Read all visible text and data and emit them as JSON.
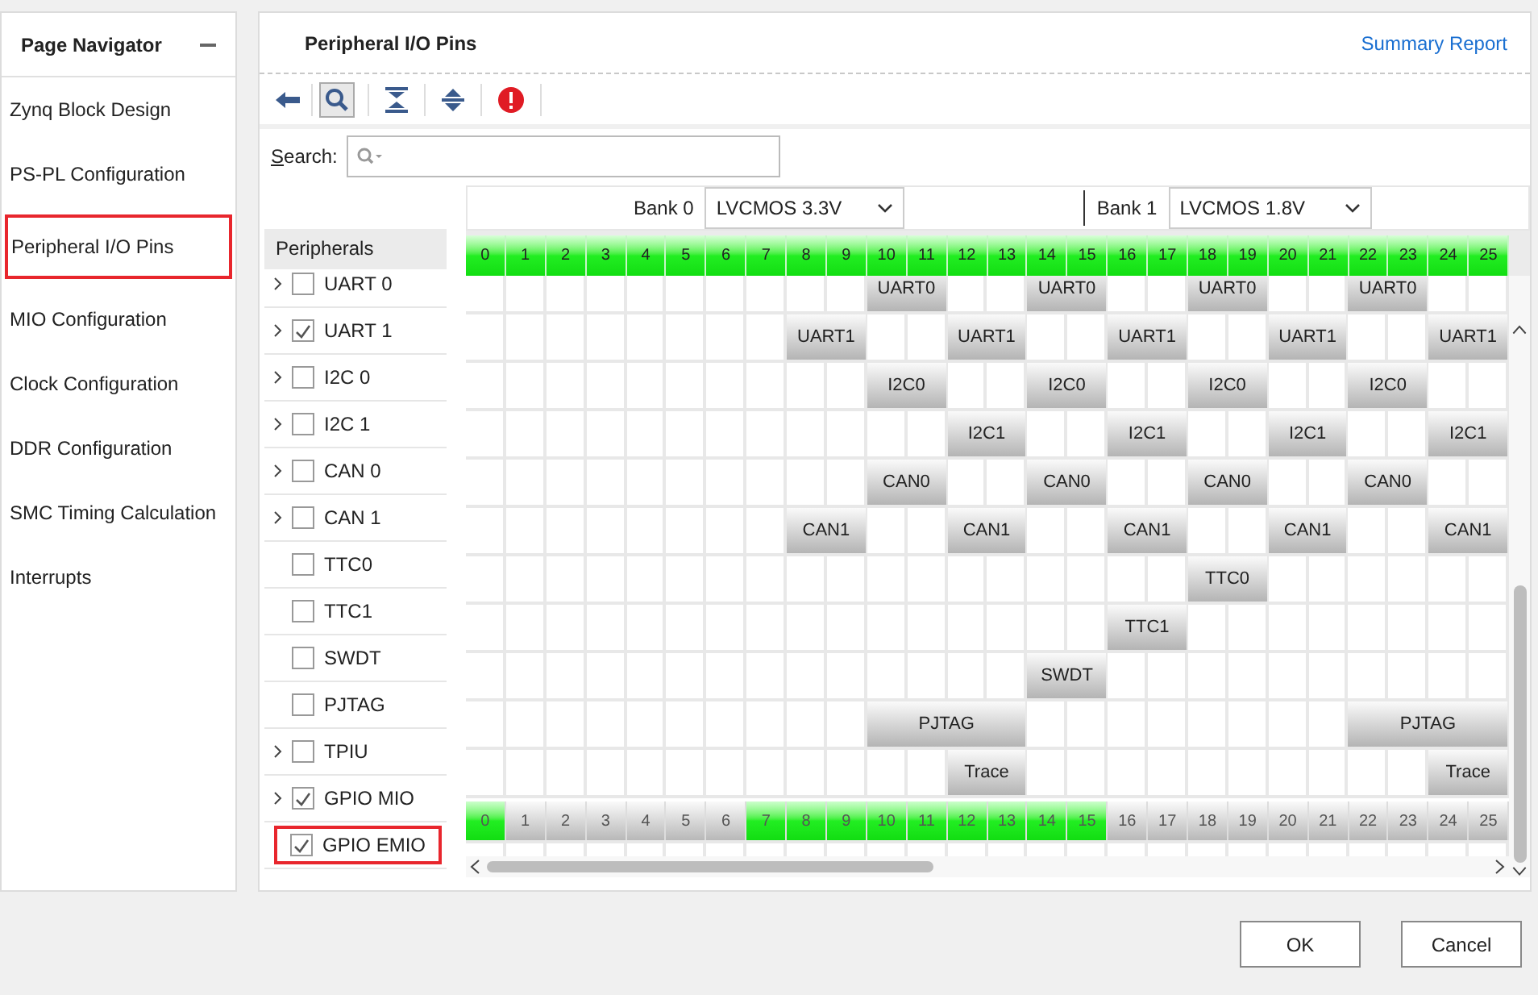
{
  "navigator": {
    "title": "Page Navigator",
    "items": [
      {
        "label": "Zynq Block Design",
        "selected": false
      },
      {
        "label": "PS-PL Configuration",
        "selected": false
      },
      {
        "label": "Peripheral I/O Pins",
        "selected": true
      },
      {
        "label": "MIO Configuration",
        "selected": false
      },
      {
        "label": "Clock Configuration",
        "selected": false
      },
      {
        "label": "DDR Configuration",
        "selected": false
      },
      {
        "label": "SMC Timing Calculation",
        "selected": false
      },
      {
        "label": "Interrupts",
        "selected": false
      }
    ]
  },
  "main": {
    "title": "Peripheral I/O Pins",
    "summary_link": "Summary Report",
    "search": {
      "label": "Search:"
    },
    "banks": [
      {
        "label": "Bank 0",
        "value": "LVCMOS 3.3V"
      },
      {
        "label": "Bank 1",
        "value": "LVCMOS 1.8V"
      }
    ],
    "peripherals_header": "Peripherals",
    "peripherals": [
      {
        "label": "UART 0",
        "expandable": true,
        "checked": false,
        "highlighted": false
      },
      {
        "label": "UART 1",
        "expandable": true,
        "checked": true,
        "highlighted": false
      },
      {
        "label": "I2C 0",
        "expandable": true,
        "checked": false,
        "highlighted": false
      },
      {
        "label": "I2C 1",
        "expandable": true,
        "checked": false,
        "highlighted": false
      },
      {
        "label": "CAN 0",
        "expandable": true,
        "checked": false,
        "highlighted": false
      },
      {
        "label": "CAN 1",
        "expandable": true,
        "checked": false,
        "highlighted": false
      },
      {
        "label": "TTC0",
        "expandable": false,
        "checked": false,
        "highlighted": false
      },
      {
        "label": "TTC1",
        "expandable": false,
        "checked": false,
        "highlighted": false
      },
      {
        "label": "SWDT",
        "expandable": false,
        "checked": false,
        "highlighted": false
      },
      {
        "label": "PJTAG",
        "expandable": false,
        "checked": false,
        "highlighted": false
      },
      {
        "label": "TPIU",
        "expandable": true,
        "checked": false,
        "highlighted": false
      },
      {
        "label": "GPIO MIO",
        "expandable": true,
        "checked": true,
        "highlighted": false
      },
      {
        "label": "GPIO EMIO",
        "expandable": false,
        "checked": true,
        "highlighted": true
      }
    ],
    "pin_header": [
      "0",
      "1",
      "2",
      "3",
      "4",
      "5",
      "6",
      "7",
      "8",
      "9",
      "10",
      "11",
      "12",
      "13",
      "14",
      "15",
      "16",
      "17",
      "18",
      "19",
      "20",
      "21",
      "22",
      "23",
      "24",
      "25"
    ],
    "pin_rows": [
      {
        "cells": [
          {
            "kind": "free"
          },
          {
            "kind": "free"
          },
          {
            "kind": "free"
          },
          {
            "kind": "free"
          },
          {
            "kind": "free"
          },
          {
            "kind": "free"
          },
          {
            "kind": "free"
          },
          {
            "kind": "free"
          },
          {
            "kind": "free"
          },
          {
            "kind": "free"
          },
          {
            "kind": "double",
            "label": "UART0"
          },
          {
            "kind": "free"
          },
          {
            "kind": "free"
          },
          {
            "kind": "double",
            "label": "UART0"
          },
          {
            "kind": "free"
          },
          {
            "kind": "free"
          },
          {
            "kind": "double",
            "label": "UART0"
          },
          {
            "kind": "free"
          },
          {
            "kind": "free"
          },
          {
            "kind": "double",
            "label": "UART0"
          },
          {
            "kind": "free"
          },
          {
            "kind": "free"
          }
        ]
      },
      {
        "cells": [
          {
            "kind": "free"
          },
          {
            "kind": "free"
          },
          {
            "kind": "free"
          },
          {
            "kind": "free"
          },
          {
            "kind": "free"
          },
          {
            "kind": "free"
          },
          {
            "kind": "free"
          },
          {
            "kind": "free"
          },
          {
            "kind": "double",
            "label": "UART1"
          },
          {
            "kind": "free"
          },
          {
            "kind": "free"
          },
          {
            "kind": "double",
            "label": "UART1"
          },
          {
            "kind": "free"
          },
          {
            "kind": "free"
          },
          {
            "kind": "double",
            "label": "UART1"
          },
          {
            "kind": "free"
          },
          {
            "kind": "free"
          },
          {
            "kind": "double",
            "label": "UART1"
          },
          {
            "kind": "free"
          },
          {
            "kind": "free"
          },
          {
            "kind": "double",
            "label": "UART1"
          }
        ]
      },
      {
        "cells": [
          {
            "kind": "free"
          },
          {
            "kind": "free"
          },
          {
            "kind": "free"
          },
          {
            "kind": "free"
          },
          {
            "kind": "free"
          },
          {
            "kind": "free"
          },
          {
            "kind": "free"
          },
          {
            "kind": "free"
          },
          {
            "kind": "free"
          },
          {
            "kind": "free"
          },
          {
            "kind": "double",
            "label": "I2C0"
          },
          {
            "kind": "free"
          },
          {
            "kind": "free"
          },
          {
            "kind": "double",
            "label": "I2C0"
          },
          {
            "kind": "free"
          },
          {
            "kind": "free"
          },
          {
            "kind": "double",
            "label": "I2C0"
          },
          {
            "kind": "free"
          },
          {
            "kind": "free"
          },
          {
            "kind": "double",
            "label": "I2C0"
          },
          {
            "kind": "free"
          },
          {
            "kind": "free"
          }
        ]
      },
      {
        "cells": [
          {
            "kind": "free"
          },
          {
            "kind": "free"
          },
          {
            "kind": "free"
          },
          {
            "kind": "free"
          },
          {
            "kind": "free"
          },
          {
            "kind": "free"
          },
          {
            "kind": "free"
          },
          {
            "kind": "free"
          },
          {
            "kind": "free"
          },
          {
            "kind": "free"
          },
          {
            "kind": "free"
          },
          {
            "kind": "free"
          },
          {
            "kind": "double",
            "label": "I2C1"
          },
          {
            "kind": "free"
          },
          {
            "kind": "free"
          },
          {
            "kind": "double",
            "label": "I2C1"
          },
          {
            "kind": "free"
          },
          {
            "kind": "free"
          },
          {
            "kind": "double",
            "label": "I2C1"
          },
          {
            "kind": "free"
          },
          {
            "kind": "free"
          },
          {
            "kind": "double",
            "label": "I2C1"
          }
        ]
      },
      {
        "cells": [
          {
            "kind": "free"
          },
          {
            "kind": "free"
          },
          {
            "kind": "free"
          },
          {
            "kind": "free"
          },
          {
            "kind": "free"
          },
          {
            "kind": "free"
          },
          {
            "kind": "free"
          },
          {
            "kind": "free"
          },
          {
            "kind": "free"
          },
          {
            "kind": "free"
          },
          {
            "kind": "double",
            "label": "CAN0"
          },
          {
            "kind": "free"
          },
          {
            "kind": "free"
          },
          {
            "kind": "double",
            "label": "CAN0"
          },
          {
            "kind": "free"
          },
          {
            "kind": "free"
          },
          {
            "kind": "double",
            "label": "CAN0"
          },
          {
            "kind": "free"
          },
          {
            "kind": "free"
          },
          {
            "kind": "double",
            "label": "CAN0"
          },
          {
            "kind": "free"
          },
          {
            "kind": "free"
          }
        ]
      },
      {
        "cells": [
          {
            "kind": "free"
          },
          {
            "kind": "free"
          },
          {
            "kind": "free"
          },
          {
            "kind": "free"
          },
          {
            "kind": "free"
          },
          {
            "kind": "free"
          },
          {
            "kind": "free"
          },
          {
            "kind": "free"
          },
          {
            "kind": "double",
            "label": "CAN1"
          },
          {
            "kind": "free"
          },
          {
            "kind": "free"
          },
          {
            "kind": "double",
            "label": "CAN1"
          },
          {
            "kind": "free"
          },
          {
            "kind": "free"
          },
          {
            "kind": "double",
            "label": "CAN1"
          },
          {
            "kind": "free"
          },
          {
            "kind": "free"
          },
          {
            "kind": "double",
            "label": "CAN1"
          },
          {
            "kind": "free"
          },
          {
            "kind": "free"
          },
          {
            "kind": "double",
            "label": "CAN1"
          }
        ]
      },
      {
        "cells": [
          {
            "kind": "free"
          },
          {
            "kind": "free"
          },
          {
            "kind": "free"
          },
          {
            "kind": "free"
          },
          {
            "kind": "free"
          },
          {
            "kind": "free"
          },
          {
            "kind": "free"
          },
          {
            "kind": "free"
          },
          {
            "kind": "free"
          },
          {
            "kind": "free"
          },
          {
            "kind": "free"
          },
          {
            "kind": "free"
          },
          {
            "kind": "free"
          },
          {
            "kind": "free"
          },
          {
            "kind": "free"
          },
          {
            "kind": "free"
          },
          {
            "kind": "free"
          },
          {
            "kind": "free"
          },
          {
            "kind": "double",
            "label": "TTC0"
          },
          {
            "kind": "free"
          },
          {
            "kind": "free"
          },
          {
            "kind": "free"
          },
          {
            "kind": "free"
          },
          {
            "kind": "free"
          },
          {
            "kind": "free"
          }
        ]
      },
      {
        "cells": [
          {
            "kind": "free"
          },
          {
            "kind": "free"
          },
          {
            "kind": "free"
          },
          {
            "kind": "free"
          },
          {
            "kind": "free"
          },
          {
            "kind": "free"
          },
          {
            "kind": "free"
          },
          {
            "kind": "free"
          },
          {
            "kind": "free"
          },
          {
            "kind": "free"
          },
          {
            "kind": "free"
          },
          {
            "kind": "free"
          },
          {
            "kind": "free"
          },
          {
            "kind": "free"
          },
          {
            "kind": "free"
          },
          {
            "kind": "free"
          },
          {
            "kind": "double",
            "label": "TTC1"
          },
          {
            "kind": "free"
          },
          {
            "kind": "free"
          },
          {
            "kind": "free"
          },
          {
            "kind": "free"
          },
          {
            "kind": "free"
          },
          {
            "kind": "free"
          },
          {
            "kind": "free"
          },
          {
            "kind": "free"
          }
        ]
      },
      {
        "cells": [
          {
            "kind": "free"
          },
          {
            "kind": "free"
          },
          {
            "kind": "free"
          },
          {
            "kind": "free"
          },
          {
            "kind": "free"
          },
          {
            "kind": "free"
          },
          {
            "kind": "free"
          },
          {
            "kind": "free"
          },
          {
            "kind": "free"
          },
          {
            "kind": "free"
          },
          {
            "kind": "free"
          },
          {
            "kind": "free"
          },
          {
            "kind": "free"
          },
          {
            "kind": "free"
          },
          {
            "kind": "double",
            "label": "SWDT"
          },
          {
            "kind": "free"
          },
          {
            "kind": "free"
          },
          {
            "kind": "free"
          },
          {
            "kind": "free"
          },
          {
            "kind": "free"
          },
          {
            "kind": "free"
          },
          {
            "kind": "free"
          },
          {
            "kind": "free"
          },
          {
            "kind": "free"
          },
          {
            "kind": "free"
          }
        ]
      },
      {
        "cells": [
          {
            "kind": "free"
          },
          {
            "kind": "free"
          },
          {
            "kind": "free"
          },
          {
            "kind": "free"
          },
          {
            "kind": "free"
          },
          {
            "kind": "free"
          },
          {
            "kind": "free"
          },
          {
            "kind": "free"
          },
          {
            "kind": "free"
          },
          {
            "kind": "free"
          },
          {
            "kind": "quad",
            "label": "PJTAG"
          },
          {
            "kind": "free"
          },
          {
            "kind": "free"
          },
          {
            "kind": "free"
          },
          {
            "kind": "free"
          },
          {
            "kind": "free"
          },
          {
            "kind": "free"
          },
          {
            "kind": "free"
          },
          {
            "kind": "free"
          },
          {
            "kind": "quad",
            "label": "PJTAG"
          }
        ]
      },
      {
        "cells": [
          {
            "kind": "free"
          },
          {
            "kind": "free"
          },
          {
            "kind": "free"
          },
          {
            "kind": "free"
          },
          {
            "kind": "free"
          },
          {
            "kind": "free"
          },
          {
            "kind": "free"
          },
          {
            "kind": "free"
          },
          {
            "kind": "free"
          },
          {
            "kind": "free"
          },
          {
            "kind": "free"
          },
          {
            "kind": "free"
          },
          {
            "kind": "double",
            "label": "Trace"
          },
          {
            "kind": "free"
          },
          {
            "kind": "free"
          },
          {
            "kind": "free"
          },
          {
            "kind": "free"
          },
          {
            "kind": "free"
          },
          {
            "kind": "free"
          },
          {
            "kind": "free"
          },
          {
            "kind": "free"
          },
          {
            "kind": "free"
          },
          {
            "kind": "free"
          },
          {
            "kind": "double",
            "label": "Trace"
          }
        ]
      }
    ],
    "pin_status": [
      {
        "number": "0",
        "used": true
      },
      {
        "number": "1",
        "used": false
      },
      {
        "number": "2",
        "used": false
      },
      {
        "number": "3",
        "used": false
      },
      {
        "number": "4",
        "used": false
      },
      {
        "number": "5",
        "used": false
      },
      {
        "number": "6",
        "used": false
      },
      {
        "number": "7",
        "used": true
      },
      {
        "number": "8",
        "used": true
      },
      {
        "number": "9",
        "used": true
      },
      {
        "number": "10",
        "used": true
      },
      {
        "number": "11",
        "used": true
      },
      {
        "number": "12",
        "used": true
      },
      {
        "number": "13",
        "used": true
      },
      {
        "number": "14",
        "used": true
      },
      {
        "number": "15",
        "used": true
      },
      {
        "number": "16",
        "used": false
      },
      {
        "number": "17",
        "used": false
      },
      {
        "number": "18",
        "used": false
      },
      {
        "number": "19",
        "used": false
      },
      {
        "number": "20",
        "used": false
      },
      {
        "number": "21",
        "used": false
      },
      {
        "number": "22",
        "used": false
      },
      {
        "number": "23",
        "used": false
      },
      {
        "number": "24",
        "used": false
      },
      {
        "number": "25",
        "used": false
      }
    ]
  },
  "buttons": [
    "OK",
    "Cancel"
  ]
}
